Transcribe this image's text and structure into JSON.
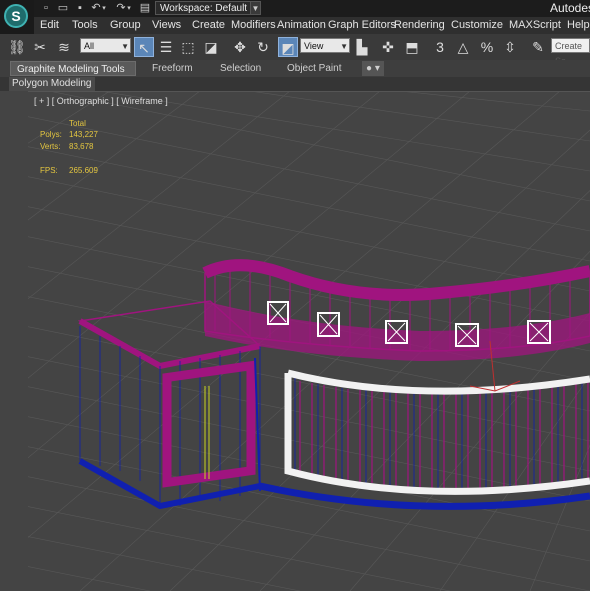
{
  "titlebar": {
    "workspace": "Workspace: Default",
    "app_title": "Autodes"
  },
  "menu": [
    "Edit",
    "Tools",
    "Group",
    "Views",
    "Create",
    "Modifiers",
    "Animation",
    "Graph Editors",
    "Rendering",
    "Customize",
    "MAXScript",
    "Help"
  ],
  "toolbar": {
    "selection_filter": "All",
    "coord_system": "View",
    "named_selection_placeholder": "Create Se"
  },
  "ribbon": {
    "tabs": [
      "Graphite Modeling Tools",
      "Freeform",
      "Selection",
      "Object Paint"
    ],
    "sub_tab": "Polygon Modeling"
  },
  "viewport": {
    "label": "[ + ] [ Orthographic ] [ Wireframe ]",
    "stats": {
      "header": "Total",
      "polys_label": "Polys:",
      "polys_value": "143,227",
      "verts_label": "Verts:",
      "verts_value": "83,678",
      "fps_label": "FPS:",
      "fps_value": "265.609"
    }
  },
  "colors": {
    "model_magenta": "#a0147f",
    "wire_blue": "#1020b0",
    "trim_white": "#f2f2f2",
    "grid": "#5a5a5a"
  }
}
